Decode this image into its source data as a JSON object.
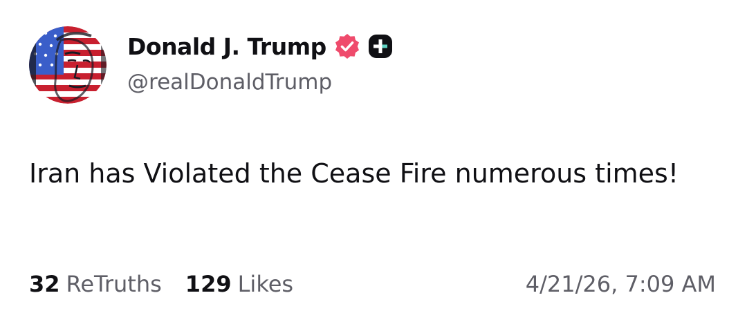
{
  "post": {
    "author": {
      "display_name": "Donald J. Trump",
      "handle": "@realDonaldTrump",
      "avatar_icon": "flag-portrait-avatar",
      "verified_icon": "verified-badge-icon",
      "extra_badge_icon": "plus-badge-icon"
    },
    "text": "Iran has Violated the Cease Fire numerous times!",
    "stats": {
      "retruths_count": "32",
      "retruths_label": "ReTruths",
      "likes_count": "129",
      "likes_label": "Likes"
    },
    "timestamp": "4/21/26, 7:09 AM"
  },
  "colors": {
    "text_primary": "#101014",
    "text_secondary": "#5e5e66",
    "verified_badge": "#ef4b6c",
    "flag_red": "#c8202f",
    "flag_blue": "#3a5ec9"
  }
}
